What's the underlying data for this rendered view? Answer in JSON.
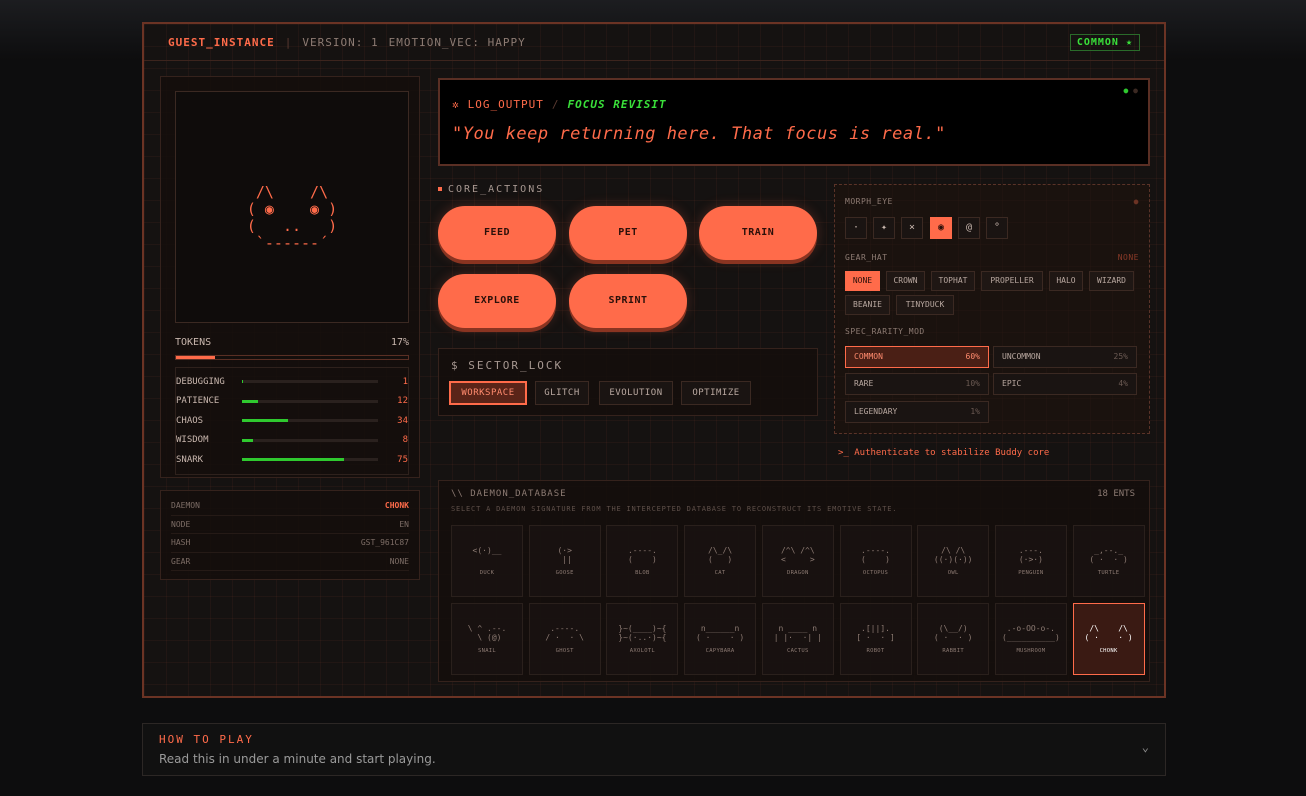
{
  "header": {
    "instance": "GUEST_INSTANCE",
    "sep": "|",
    "version": "VERSION: 1",
    "emotion": "EMOTION_VEC: HAPPY",
    "rarity_badge": "COMMON ★"
  },
  "pet": {
    "ascii": " /\\    /\\ \n( ◉    ◉ )\n(   ..   )\n `------´ ",
    "tokens_label": "TOKENS",
    "tokens_pct": "17%",
    "tokens_fill": 0.17
  },
  "stats": [
    {
      "name": "DEBUGGING",
      "value": "1",
      "fill": 0.01
    },
    {
      "name": "PATIENCE",
      "value": "12",
      "fill": 0.12
    },
    {
      "name": "CHAOS",
      "value": "34",
      "fill": 0.34
    },
    {
      "name": "WISDOM",
      "value": "8",
      "fill": 0.08
    },
    {
      "name": "SNARK",
      "value": "75",
      "fill": 0.75
    }
  ],
  "info": [
    {
      "k": "DAEMON",
      "v": "CHONK"
    },
    {
      "k": "NODE",
      "v": "EN"
    },
    {
      "k": "HASH",
      "v": "GST_961C87"
    },
    {
      "k": "GEAR",
      "v": "NONE"
    }
  ],
  "log": {
    "icon": "✲",
    "label": "LOG_OUTPUT",
    "sep": "/",
    "event": "FOCUS REVISIT",
    "quote": "\"You keep returning here. That focus is real.\"",
    "dots": "● ●"
  },
  "actions": {
    "title": "CORE_ACTIONS",
    "buttons": [
      "FEED",
      "PET",
      "TRAIN",
      "EXPLORE",
      "SPRINT"
    ]
  },
  "sector": {
    "title": "$ SECTOR_LOCK",
    "chips": [
      "WORKSPACE",
      "GLITCH",
      "EVOLUTION",
      "OPTIMIZE"
    ]
  },
  "morph": {
    "eye_label": "MORPH_EYE",
    "eye_dot": "●",
    "eyes": [
      "·",
      "✦",
      "×",
      "◉",
      "@",
      "°"
    ],
    "hat_label": "GEAR_HAT",
    "hat_value": "NONE",
    "hats": [
      "NONE",
      "CROWN",
      "TOPHAT",
      "PROPELLER",
      "HALO",
      "WIZARD",
      "BEANIE",
      "TINYDUCK"
    ],
    "rarity_label": "SPEC_RARITY_MOD",
    "rarities": [
      {
        "n": "COMMON",
        "p": "60%"
      },
      {
        "n": "UNCOMMON",
        "p": "25%"
      },
      {
        "n": "RARE",
        "p": "10%"
      },
      {
        "n": "EPIC",
        "p": "4%"
      },
      {
        "n": "LEGENDARY",
        "p": "1%"
      }
    ]
  },
  "auth": ">_ Authenticate to stabilize Buddy core",
  "database": {
    "title": "\\\\ DAEMON_DATABASE",
    "count": "18 ENTS",
    "subtitle": "SELECT A DAEMON SIGNATURE FROM THE INTERCEPTED DATABASE TO RECONSTRUCT ITS EMOTIVE STATE.",
    "entries": [
      {
        "n": "DUCK",
        "a": "<(·)__"
      },
      {
        "n": "GOOSE",
        "a": "(·>\n ||"
      },
      {
        "n": "BLOB",
        "a": ".----.\n(    )"
      },
      {
        "n": "CAT",
        "a": "/\\_/\\\n(   )"
      },
      {
        "n": "DRAGON",
        "a": "/^\\ /^\\\n<     >"
      },
      {
        "n": "OCTOPUS",
        "a": ".----.\n(    )"
      },
      {
        "n": "OWL",
        "a": "/\\ /\\\n((·)(·))"
      },
      {
        "n": "PENGUIN",
        "a": ".---.\n(·>·)"
      },
      {
        "n": "TURTLE",
        "a": "_,--._\n( ·  · )"
      },
      {
        "n": "SNAIL",
        "a": "\\ ^ .--.\n \\ (@)"
      },
      {
        "n": "GHOST",
        "a": ".----.\n/ ·  · \\"
      },
      {
        "n": "AXOLOTL",
        "a": "}~(____)~{\n}~(·..·)~{"
      },
      {
        "n": "CAPYBARA",
        "a": "n______n\n( ·    · )"
      },
      {
        "n": "CACTUS",
        "a": "n ____ n\n| |·  ·| |"
      },
      {
        "n": "ROBOT",
        "a": ".[||].\n[ ·  · ]"
      },
      {
        "n": "RABBIT",
        "a": "(\\__/)\n( ·  · )"
      },
      {
        "n": "MUSHROOM",
        "a": ".-o-OO-o-.\n(__________)"
      },
      {
        "n": "CHONK",
        "a": "/\\    /\\\n( ·    · )"
      }
    ]
  },
  "howto": {
    "title": "HOW TO PLAY",
    "subtitle": "Read this in under a minute and start playing.",
    "chevron": "⌄"
  }
}
